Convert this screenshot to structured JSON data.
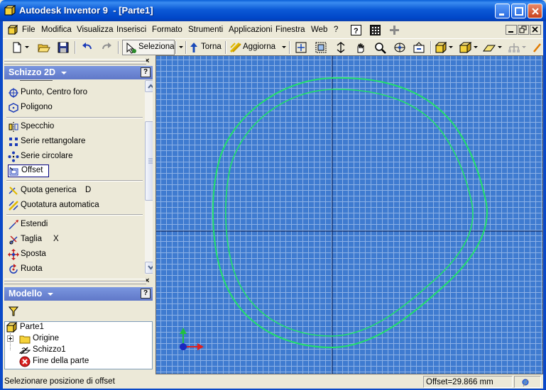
{
  "window": {
    "title": "Autodesk Inventor 9  - [Parte1]"
  },
  "menu": {
    "items": [
      {
        "label": "File",
        "key": "F"
      },
      {
        "label": "Modifica",
        "key": "M"
      },
      {
        "label": "Visualizza",
        "key": "V"
      },
      {
        "label": "Inserisci",
        "key": "I"
      },
      {
        "label": "Formato",
        "key": "F"
      },
      {
        "label": "Strumenti",
        "key": "S"
      },
      {
        "label": "Applicazioni",
        "key": "A"
      },
      {
        "label": "Finestra",
        "key": "n"
      },
      {
        "label": "Web",
        "key": "b"
      },
      {
        "label": "?",
        "key": "?"
      }
    ]
  },
  "toolbar": {
    "select_label": "Seleziona",
    "back_label": "Torna",
    "update_label": "Aggiorna"
  },
  "sketch_panel": {
    "title": "Schizzo 2D",
    "help": "?",
    "commands": [
      {
        "label": "Punto, Centro foro",
        "key": "",
        "icon": "point-center-hole-icon"
      },
      {
        "label": "Poligono",
        "key": "",
        "icon": "polygon-icon"
      },
      {
        "label": "Specchio",
        "key": "",
        "icon": "mirror-icon"
      },
      {
        "label": "Serie rettangolare",
        "key": "",
        "icon": "rectangular-pattern-icon"
      },
      {
        "label": "Serie circolare",
        "key": "",
        "icon": "circular-pattern-icon"
      },
      {
        "label": "Offset",
        "key": "",
        "icon": "offset-icon"
      },
      {
        "label": "Quota generica",
        "key": "D",
        "icon": "general-dimension-icon"
      },
      {
        "label": "Quotatura automatica",
        "key": "",
        "icon": "auto-dimension-icon"
      },
      {
        "label": "Estendi",
        "key": "",
        "icon": "extend-icon"
      },
      {
        "label": "Taglia",
        "key": "X",
        "icon": "trim-icon"
      },
      {
        "label": "Sposta",
        "key": "",
        "icon": "move-icon"
      },
      {
        "label": "Ruota",
        "key": "",
        "icon": "rotate-icon"
      }
    ]
  },
  "model_panel": {
    "title": "Modello",
    "help": "?",
    "tree": [
      {
        "label": "Parte1",
        "icon": "part-icon"
      },
      {
        "label": "Origine",
        "icon": "folder-icon"
      },
      {
        "label": "Schizzo1",
        "icon": "sketch-icon"
      },
      {
        "label": "Fine della parte",
        "icon": "end-of-part-icon"
      }
    ]
  },
  "status": {
    "message": "Selezionare posizione di offset",
    "offset": "Offset=29.866 mm"
  },
  "colors": {
    "canvas_bg": "#3f7bd0",
    "grid": "#8cb1e6",
    "sketch_curve": "#22e06a",
    "title_bar": "#0046c8"
  }
}
